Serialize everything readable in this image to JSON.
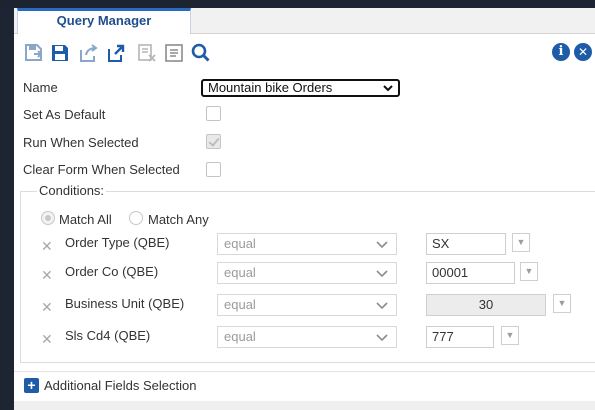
{
  "tab": {
    "label": "Query Manager"
  },
  "toolbar": {
    "icons": [
      "save-as-icon",
      "save-icon",
      "share-icon",
      "publish-icon",
      "clear-icon",
      "notes-icon",
      "search-icon"
    ],
    "info_glyph": "i",
    "close_glyph": "✕"
  },
  "form": {
    "name_label": "Name",
    "name_value": "Mountain bike Orders",
    "set_default_label": "Set As Default",
    "set_default_checked": false,
    "run_selected_label": "Run When Selected",
    "run_selected_checked": true,
    "clear_form_label": "Clear Form When Selected",
    "clear_form_checked": false
  },
  "conditions": {
    "legend": "Conditions:",
    "match_all_label": "Match All",
    "match_any_label": "Match Any",
    "selected_match": "all",
    "rows": [
      {
        "field": "Order Type (QBE)",
        "operator": "equal",
        "value": "SX"
      },
      {
        "field": "Order Co (QBE)",
        "operator": "equal",
        "value": "00001"
      },
      {
        "field": "Business Unit (QBE)",
        "operator": "equal",
        "value": "30"
      },
      {
        "field": "Sls Cd4 (QBE)",
        "operator": "equal",
        "value": "777"
      }
    ]
  },
  "additional": {
    "label": "Additional Fields Selection"
  },
  "colors": {
    "accent": "#1f5ca8",
    "tab_title": "#1f4e8c",
    "background": "#1d2532"
  }
}
